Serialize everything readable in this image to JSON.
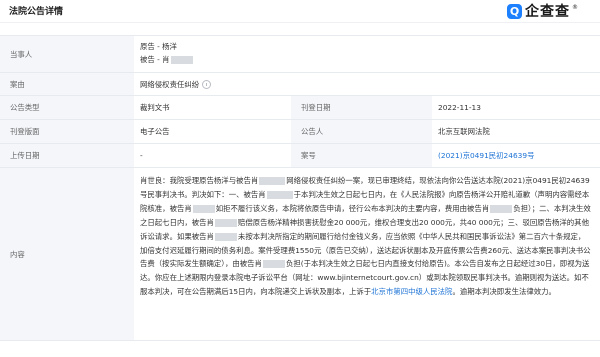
{
  "header": {
    "title": "法院公告详情",
    "brand_icon": "Q",
    "brand_name": "企查查",
    "brand_tm": "®"
  },
  "rows": {
    "party": {
      "label": "当事人",
      "plaintiff": "原告 - 杨洋",
      "defendant": "被告 - 肖"
    },
    "case_cause": {
      "label": "案由",
      "value": "网络侵权责任纠纷"
    },
    "notice_type": {
      "label": "公告类型",
      "value": "裁判文书",
      "label2": "刊登日期",
      "value2": "2022-11-13"
    },
    "publish_page": {
      "label": "刊登版面",
      "value": "电子公告",
      "label2": "公告人",
      "value2": "北京互联网法院"
    },
    "upload_date": {
      "label": "上传日期",
      "value": "-",
      "label2": "案号",
      "value2": "(2021)京0491民初24639号"
    },
    "content": {
      "label": "内容",
      "p1": "肖世良：我院受理原告杨洋与被告肖",
      "p2": "网络侵权责任纠纷一案，现已审理终结，现依法向你公告送达本院(2021)京0491民初24639号民事判决书。判决如下：一、被告肖",
      "p3": "于本判决生效之日起七日内，在《人民法院报》向原告杨洋公开赔礼道歉（声明内容需经本院核准，被告肖",
      "p4": "如拒不履行该义务，本院将依原告申请，径行公布本判决的主要内容，费用由被告肖",
      "p5": "负担）；二、本判决生效之日起七日内，被告肖",
      "p6": "赔偿原告杨洋精神损害抚慰金20 000元，维权合理支出20 000元，共40 000元；三、驳回原告杨洋的其他诉讼请求。如果被告肖",
      "p7": "未按本判决所指定的期间履行给付金钱义务，应当依照《中华人民共和国民事诉讼法》第二百六十条规定，加倍支付迟延履行期间的债务利息。案件受理费1550元（原告已交纳），送达起诉状副本及开庭传票公告费260元、送达本案民事判决书公告费（按实际发生额确定），由被告肖",
      "p8": "负担(于本判决生效之日起七日内直接支付给原告)。本公告自发布之日起经过30日，即视为送达。你应在上述期限内登录本院电子诉讼平台（网址：www.bjinternetcourt.gov.cn）或到本院领取民事判决书。逾期则视为送达。如不服本判决，可在公告期满后15日内，向本院递交上诉状及副本，上诉于",
      "link": "北京市第四中级人民法院",
      "p9": "。逾期本判决即发生法律效力。"
    }
  }
}
